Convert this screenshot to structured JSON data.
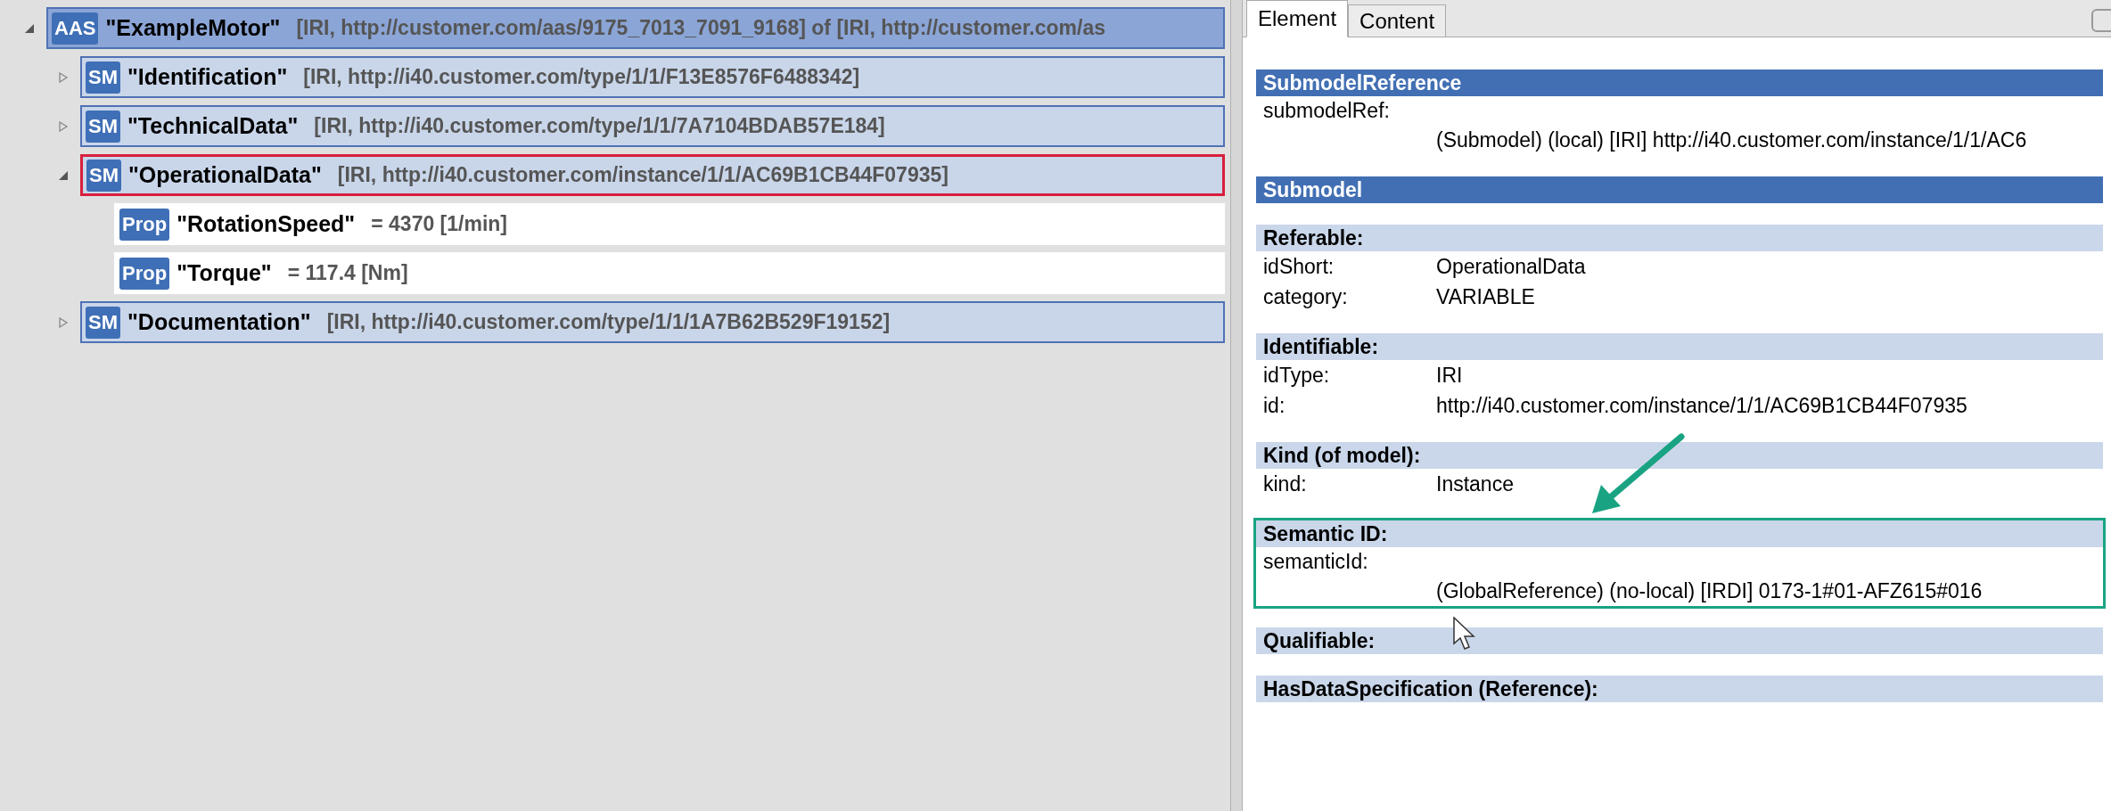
{
  "tree": {
    "badge": "AAS",
    "name": "\"ExampleMotor\"",
    "info": "[IRI, http://customer.com/aas/9175_7013_7091_9168] of [IRI, http://customer.com/as",
    "kind": "aas",
    "expanded": true,
    "selected": false,
    "children": [
      {
        "badge": "SM",
        "name": "\"Identification\"",
        "info": "[IRI, http://i40.customer.com/type/1/1/F13E8576F6488342]",
        "kind": "submodel",
        "expanded": false,
        "selected": false
      },
      {
        "badge": "SM",
        "name": "\"TechnicalData\"",
        "info": "[IRI, http://i40.customer.com/type/1/1/7A7104BDAB57E184]",
        "kind": "submodel",
        "expanded": false,
        "selected": false
      },
      {
        "badge": "SM",
        "name": "\"OperationalData\"",
        "info": "[IRI, http://i40.customer.com/instance/1/1/AC69B1CB44F07935]",
        "kind": "submodel",
        "expanded": true,
        "selected": true,
        "children": [
          {
            "badge": "Prop",
            "name": "\"RotationSpeed\"",
            "info": "= 4370 [1/min]",
            "kind": "property",
            "selected": false
          },
          {
            "badge": "Prop",
            "name": "\"Torque\"",
            "info": "= 117.4 [Nm]",
            "kind": "property",
            "selected": false
          }
        ]
      },
      {
        "badge": "SM",
        "name": "\"Documentation\"",
        "info": "[IRI, http://i40.customer.com/type/1/1/1A7B62B529F19152]",
        "kind": "submodel",
        "expanded": false,
        "selected": false
      }
    ]
  },
  "tabs": [
    {
      "label": "Element",
      "selected": true
    },
    {
      "label": "Content",
      "selected": false
    }
  ],
  "sections": [
    {
      "title": "SubmodelReference",
      "kind": "main",
      "highlighted": false,
      "fields": [
        {
          "label": "submodelRef:",
          "value": "(Submodel) (local) [IRI] http://i40.customer.com/instance/1/1/AC6",
          "kind": "wrapped"
        }
      ]
    },
    {
      "title": "Submodel",
      "kind": "main",
      "highlighted": false
    },
    {
      "title": "Referable:",
      "kind": "sub",
      "highlighted": false,
      "fields": [
        {
          "label": "idShort:",
          "value": "OperationalData",
          "kind": "inline"
        },
        {
          "label": "category:",
          "value": "VARIABLE",
          "kind": "inline"
        }
      ]
    },
    {
      "title": "Identifiable:",
      "kind": "sub",
      "highlighted": false,
      "fields": [
        {
          "label": "idType:",
          "value": "IRI",
          "kind": "inline"
        },
        {
          "label": "id:",
          "value": "http://i40.customer.com/instance/1/1/AC69B1CB44F07935",
          "kind": "inline"
        }
      ]
    },
    {
      "title": "Kind (of model):",
      "kind": "sub",
      "highlighted": false,
      "fields": [
        {
          "label": "kind:",
          "value": "Instance",
          "kind": "inline"
        }
      ]
    },
    {
      "title": "Semantic ID:",
      "kind": "sub",
      "highlighted": true,
      "fields": [
        {
          "label": "semanticId:",
          "value": "(GlobalReference) (no-local) [IRDI] 0173-1#01-AFZ615#016",
          "kind": "wrapped"
        }
      ]
    },
    {
      "title": "Qualifiable:",
      "kind": "sub",
      "highlighted": false
    },
    {
      "title": "HasDataSpecification (Reference):",
      "kind": "sub",
      "highlighted": false
    }
  ]
}
